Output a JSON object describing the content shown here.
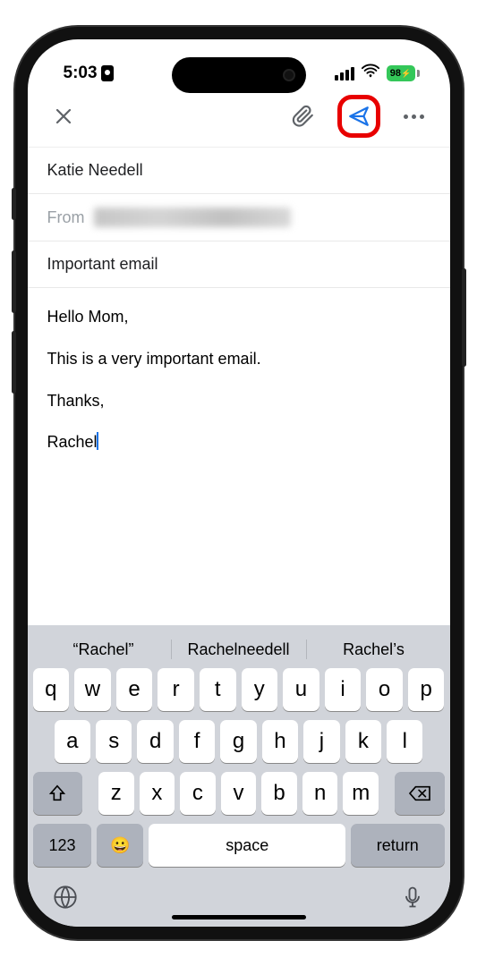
{
  "status": {
    "time": "5:03",
    "battery_text": "98"
  },
  "toolbar": {
    "close": "close",
    "attach": "attachment",
    "send": "send",
    "more": "more"
  },
  "compose": {
    "to": "Katie Needell",
    "from_label": "From",
    "subject": "Important email",
    "body": {
      "line1": "Hello Mom,",
      "line2": "This is a very important email.",
      "line3": "Thanks,",
      "signature": "Rachel"
    }
  },
  "suggestions": [
    "“Rachel”",
    "Rachelneedell",
    "Rachel’s"
  ],
  "keys": {
    "row1": [
      "q",
      "w",
      "e",
      "r",
      "t",
      "y",
      "u",
      "i",
      "o",
      "p"
    ],
    "row2": [
      "a",
      "s",
      "d",
      "f",
      "g",
      "h",
      "j",
      "k",
      "l"
    ],
    "row3": [
      "z",
      "x",
      "c",
      "v",
      "b",
      "n",
      "m"
    ],
    "nums": "123",
    "space": "space",
    "return": "return"
  }
}
